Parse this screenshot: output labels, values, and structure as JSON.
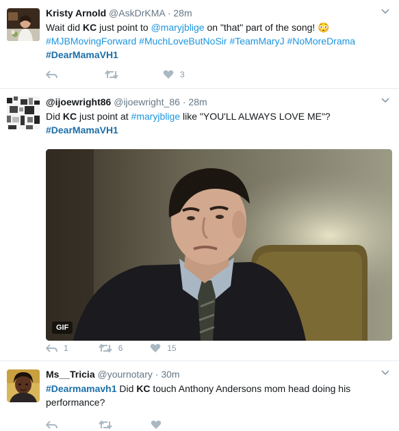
{
  "tweets": [
    {
      "name": "Kristy Arnold",
      "handle": "@AskDrKMA",
      "dot": "·",
      "time": "28m",
      "avatar_icon": "profile-photo",
      "text": {
        "p1": "Wait did ",
        "kc": "KC",
        "p2": " just point to ",
        "mention": "@maryjblige",
        "p3": " on \"that\" part of the song! ",
        "emoji": "😳"
      },
      "hashtags": [
        "#MJBMovingForward",
        "#MuchLoveButNoSir",
        "#TeamMaryJ",
        "#NoMoreDrama"
      ],
      "strong_hashtag": "#DearMamaVH1",
      "actions": {
        "reply": "",
        "retweet": "",
        "like": "3"
      }
    },
    {
      "name": "@ijoewright86",
      "handle": "@ijoewright_86",
      "dot": "·",
      "time": "28m",
      "avatar_icon": "pixel-art-avatar",
      "text": {
        "p1": "Did ",
        "kc": "KC",
        "p2": " just point at ",
        "mention": "#maryjblige",
        "p3": " like \"YOU'LL ALWAYS LOVE ME\"?"
      },
      "strong_hashtag": "#DearMamaVH1",
      "media": {
        "badge": "GIF",
        "icon": "gif-man-in-suit"
      },
      "actions": {
        "reply": "1",
        "retweet": "6",
        "like": "15"
      }
    },
    {
      "name": "Ms__Tricia",
      "handle": "@yournotary",
      "dot": "·",
      "time": "30m",
      "avatar_icon": "profile-photo",
      "text": {
        "hashtag": "#Dearmamavh1",
        "p1": " Did ",
        "kc": "KC",
        "p2": " touch Anthony Andersons mom head doing his performance?"
      }
    }
  ],
  "colors": {
    "link": "#1b95e0",
    "strong_hashtag": "#1b6ea8",
    "muted": "#657786",
    "icon": "#aab8c2",
    "divider": "#e6ecf0"
  }
}
